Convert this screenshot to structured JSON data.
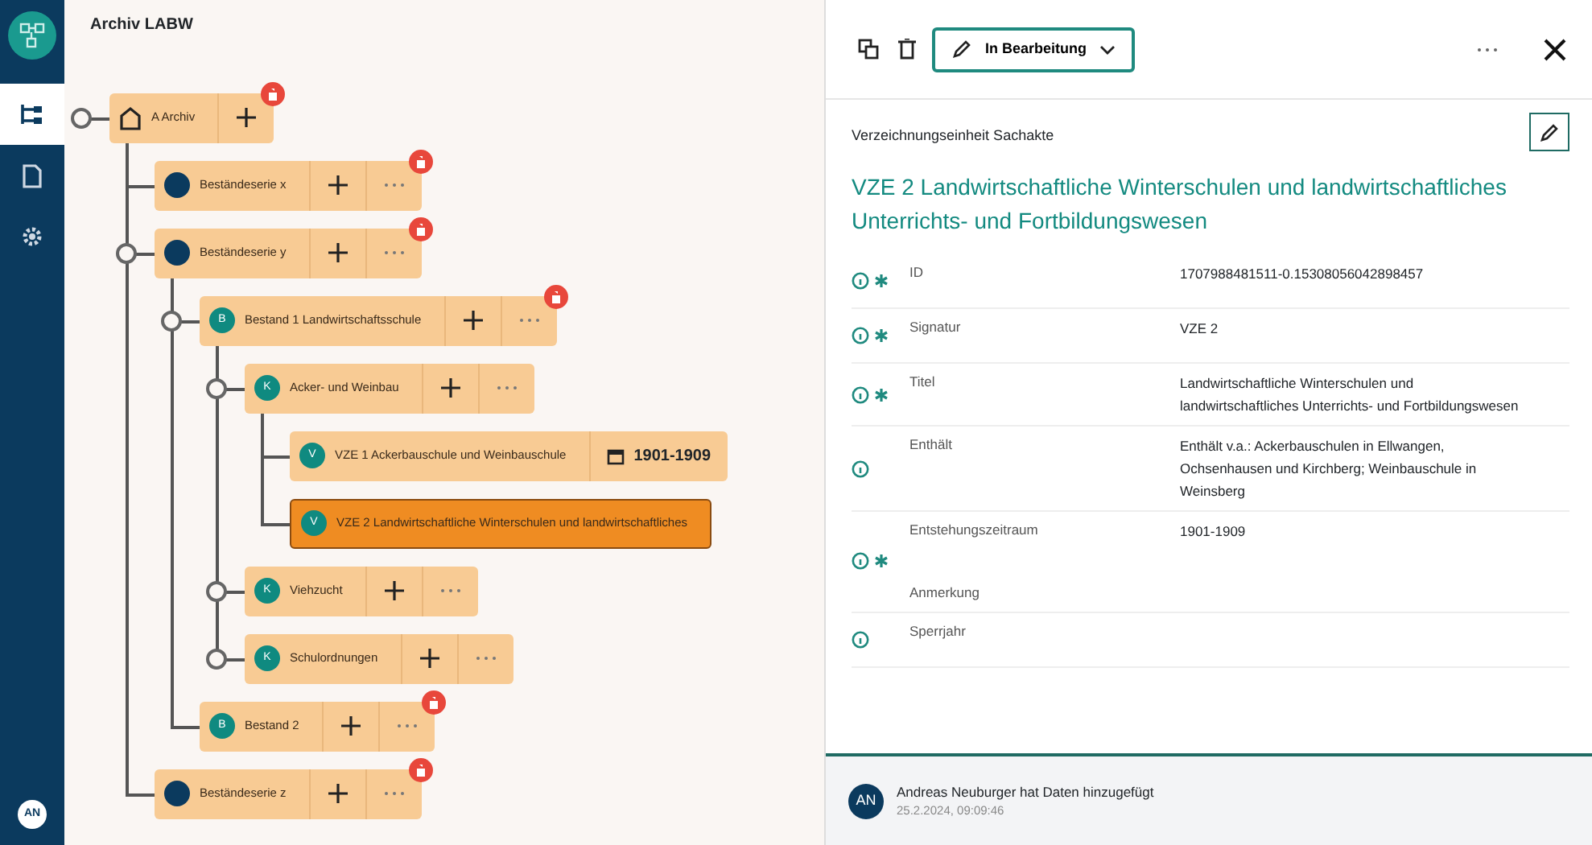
{
  "sidebar": {
    "items": [
      {
        "kind": "tree",
        "selected": true
      },
      {
        "kind": "document",
        "selected": false
      },
      {
        "kind": "settings",
        "selected": false
      }
    ],
    "user_initials": "AN"
  },
  "canvas": {
    "title": "Archiv LABW",
    "tree": [
      {
        "kind": "root",
        "label": "A Archiv",
        "toggle": true,
        "add": true,
        "more": false,
        "delete": true,
        "selected": false,
        "children": [
          {
            "kind": "series",
            "label": "Beständeserie x",
            "toggle": false,
            "add": true,
            "more": true,
            "delete": true,
            "selected": false
          },
          {
            "kind": "series",
            "label": "Beständeserie y",
            "toggle": true,
            "add": true,
            "more": true,
            "delete": true,
            "selected": false,
            "children": [
              {
                "kind": "unit",
                "badge": "B",
                "label": "Bestand 1 Landwirtschaftsschule",
                "toggle": true,
                "add": true,
                "more": true,
                "delete": true,
                "selected": false,
                "children": [
                  {
                    "kind": "unit",
                    "badge": "K",
                    "label": "Acker- und Weinbau",
                    "toggle": true,
                    "add": true,
                    "more": true,
                    "delete": false,
                    "selected": false,
                    "children": [
                      {
                        "kind": "unit",
                        "badge": "V",
                        "label": "VZE 1  Ackerbauschule und Weinbauschule",
                        "toggle": false,
                        "add": false,
                        "more": false,
                        "delete": false,
                        "date": "1901-1909",
                        "selected": false
                      },
                      {
                        "kind": "unit",
                        "badge": "V",
                        "label": "VZE 2  Landwirtschaftliche Winterschulen und landwirtschaftliches",
                        "toggle": false,
                        "add": false,
                        "more": false,
                        "delete": false,
                        "selected": true
                      }
                    ]
                  },
                  {
                    "kind": "unit",
                    "badge": "K",
                    "label": "Viehzucht",
                    "toggle": true,
                    "add": true,
                    "more": true,
                    "delete": false,
                    "selected": false
                  },
                  {
                    "kind": "unit",
                    "badge": "K",
                    "label": "Schulordnungen",
                    "toggle": true,
                    "add": true,
                    "more": true,
                    "delete": false,
                    "selected": false
                  }
                ]
              },
              {
                "kind": "unit",
                "badge": "B",
                "label": "Bestand 2",
                "toggle": false,
                "add": true,
                "more": true,
                "delete": true,
                "selected": false
              }
            ]
          },
          {
            "kind": "series",
            "label": "Beständeserie z",
            "toggle": false,
            "add": true,
            "more": true,
            "delete": true,
            "selected": false
          }
        ]
      }
    ]
  },
  "detail": {
    "status": "In Bearbeitung",
    "type": "Verzeichnungseinheit Sachakte",
    "title": "VZE 2 Landwirtschaftliche Winterschulen und landwirtschaftliches Unterrichts- und Fortbildungswesen",
    "fields": [
      {
        "labels": [
          "ID"
        ],
        "value": "1707988481511-0.15308056042898457",
        "required": true
      },
      {
        "labels": [
          "Signatur"
        ],
        "value": "VZE 2",
        "required": true
      },
      {
        "labels": [
          "Titel"
        ],
        "value": "Landwirtschaftliche Winterschulen und landwirtschaftliches Unterrichts- und Fortbildungswesen",
        "required": true
      },
      {
        "labels": [
          "Enthält"
        ],
        "value": "Enthält v.a.: Ackerbauschulen in Ellwangen, Ochsenhausen und Kirchberg; Weinbauschule in Weinsberg",
        "required": false
      },
      {
        "labels": [
          "Entstehungszeitraum",
          "Anmerkung"
        ],
        "value": "1901-1909",
        "required": true
      },
      {
        "labels": [
          "Sperrjahr"
        ],
        "required": false
      }
    ],
    "activity": {
      "initials": "AN",
      "text": "Andreas Neuburger hat Daten hinzugefügt",
      "time": "25.2.2024, 09:09:46"
    }
  }
}
